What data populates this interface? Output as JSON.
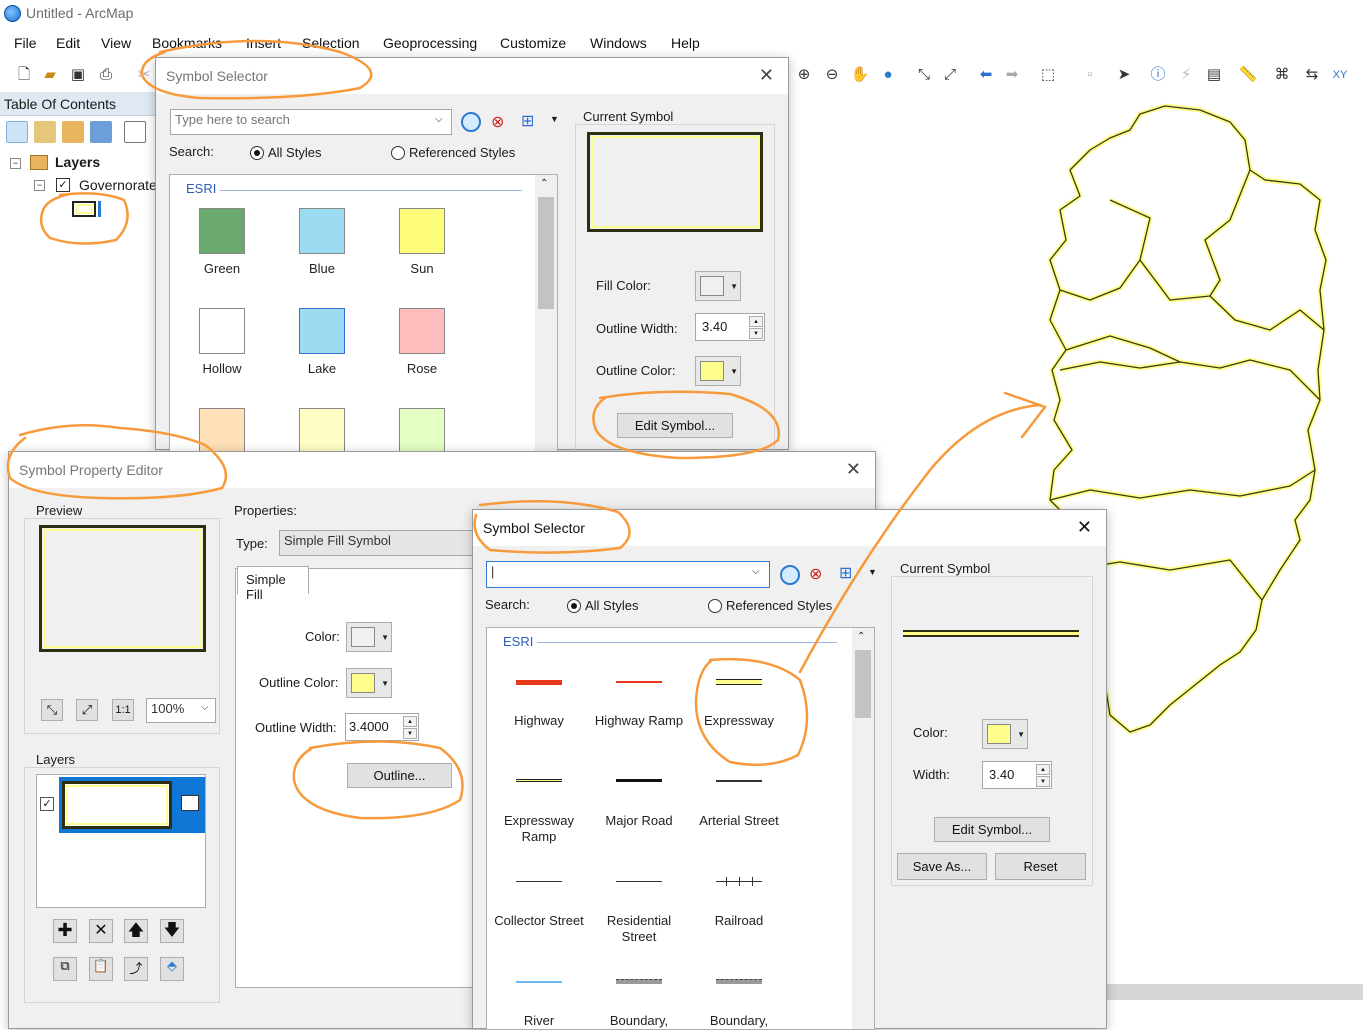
{
  "app": {
    "title": "Untitled - ArcMap"
  },
  "menu": [
    "File",
    "Edit",
    "View",
    "Bookmarks",
    "Insert",
    "Selection",
    "Geoprocessing",
    "Customize",
    "Windows",
    "Help"
  ],
  "toc": {
    "title": "Table Of Contents",
    "root": "Layers",
    "layer": "Governorates"
  },
  "selector1": {
    "title": "Symbol Selector",
    "search_placeholder": "Type here to search",
    "search_label": "Search:",
    "opt_all": "All Styles",
    "opt_ref": "Referenced Styles",
    "group": "ESRI",
    "swatches": [
      {
        "label": "Green",
        "color": "#6aaa6e"
      },
      {
        "label": "Blue",
        "color": "#9bdcf2"
      },
      {
        "label": "Sun",
        "color": "#fdfd7a"
      },
      {
        "label": "Hollow",
        "color": "#ffffff"
      },
      {
        "label": "Lake",
        "color": "#9bdcf2"
      },
      {
        "label": "Rose",
        "color": "#ffbcbc"
      }
    ],
    "current_symbol": "Current Symbol",
    "fill_color": "Fill Color:",
    "outline_width_label": "Outline Width:",
    "outline_width": "3.40",
    "outline_color": "Outline Color:",
    "edit_symbol": "Edit Symbol..."
  },
  "prop_editor": {
    "title": "Symbol Property Editor",
    "preview": "Preview",
    "zoom": "100%",
    "layers": "Layers",
    "properties": "Properties:",
    "type_label": "Type:",
    "type_value": "Simple Fill Symbol",
    "tab": "Simple Fill",
    "color": "Color:",
    "outline_color": "Outline Color:",
    "outline_width_label": "Outline Width:",
    "outline_width": "3.4000",
    "outline_btn": "Outline..."
  },
  "selector2": {
    "title": "Symbol Selector",
    "search_label": "Search:",
    "opt_all": "All Styles",
    "opt_ref": "Referenced Styles",
    "group": "ESRI",
    "items": [
      {
        "label": "Highway"
      },
      {
        "label": "Highway Ramp"
      },
      {
        "label": "Expressway"
      },
      {
        "label": "Expressway Ramp"
      },
      {
        "label": "Major Road"
      },
      {
        "label": "Arterial Street"
      },
      {
        "label": "Collector Street"
      },
      {
        "label": "Residential Street"
      },
      {
        "label": "Railroad"
      },
      {
        "label": "River"
      },
      {
        "label": "Boundary,"
      },
      {
        "label": "Boundary,"
      }
    ],
    "current_symbol": "Current Symbol",
    "color_label": "Color:",
    "width_label": "Width:",
    "width": "3.40",
    "edit_symbol": "Edit Symbol...",
    "save_as": "Save As...",
    "reset": "Reset"
  },
  "colors": {
    "yellow": "#fefe8c",
    "annotation": "#f79a3c",
    "outline_dark": "#3a3a1a"
  }
}
